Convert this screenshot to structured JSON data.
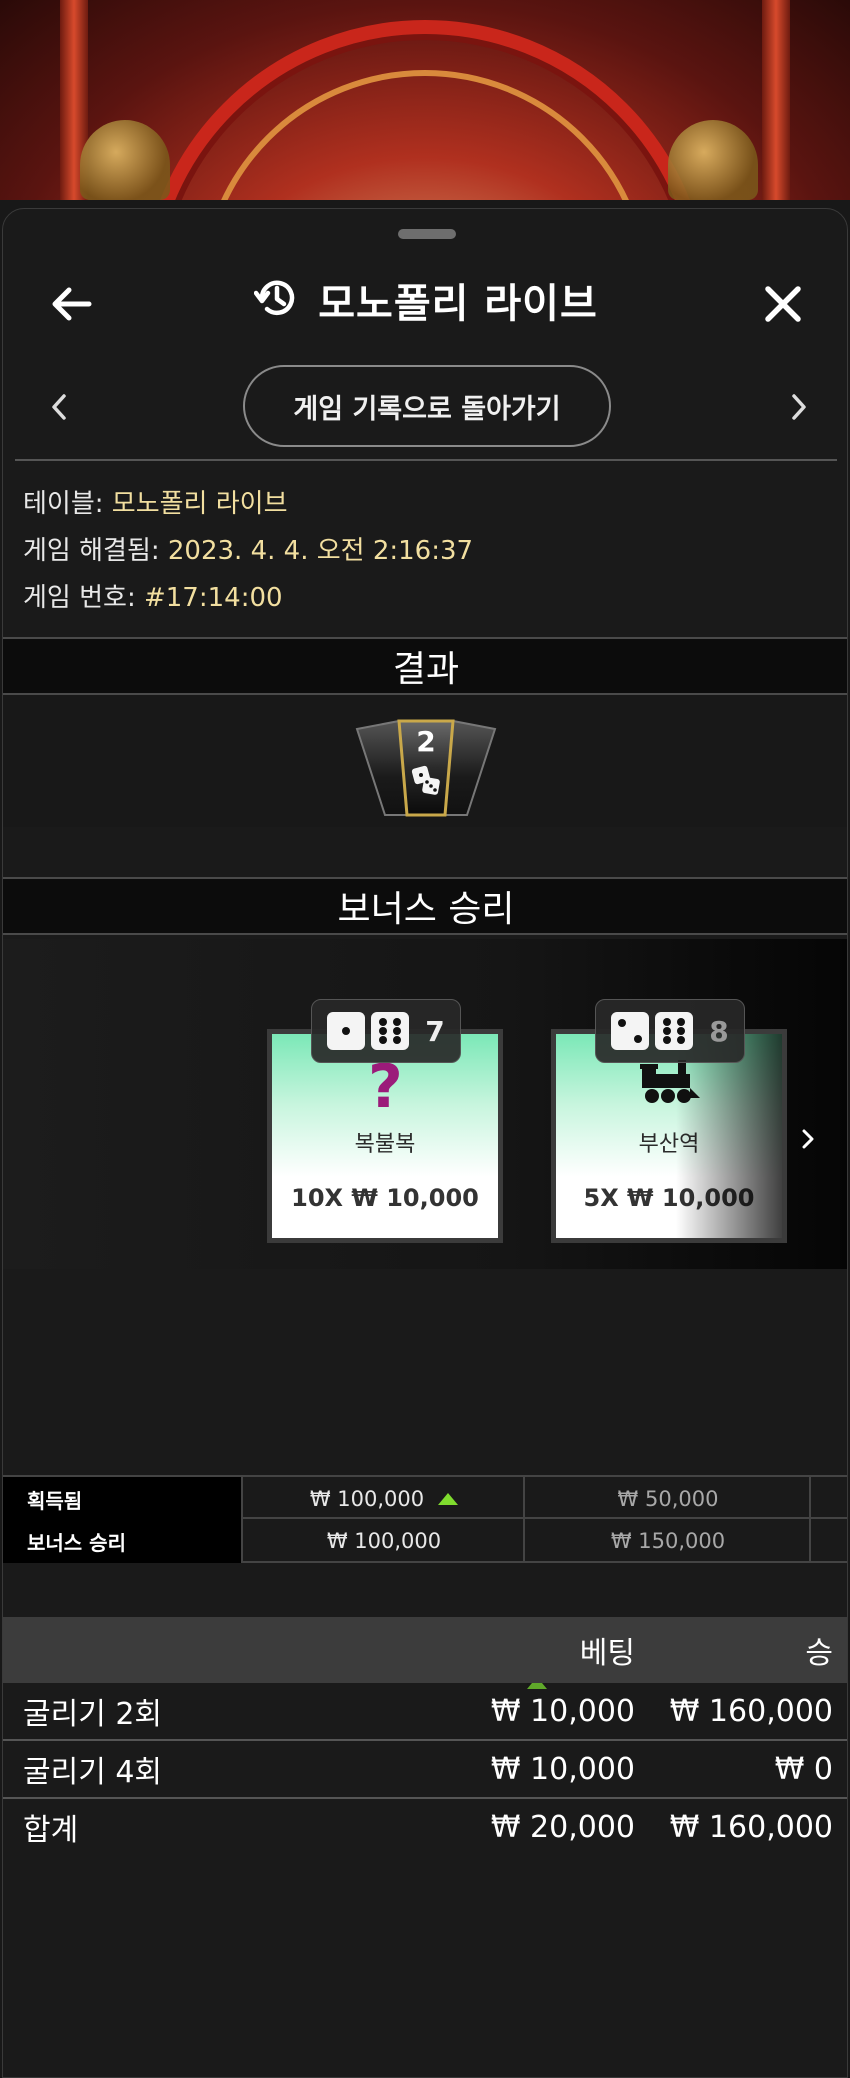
{
  "header": {
    "title": "모노폴리 라이브",
    "back_icon": "arrow-left-icon",
    "history_icon": "history-icon",
    "close_icon": "close-icon"
  },
  "nav": {
    "back_to_history_label": "게임 기록으로 돌아가기"
  },
  "info": {
    "table_label": "테이블:",
    "table_value": "모노폴리 라이브",
    "resolved_label": "게임 해결됨:",
    "resolved_value": "2023. 4. 4. 오전 2:16:37",
    "game_no_label": "게임 번호:",
    "game_no_value": "#17:14:00"
  },
  "result": {
    "heading": "결과",
    "segment_value": "2"
  },
  "bonus": {
    "heading": "보너스 승리",
    "tiles": [
      {
        "dice_sum": "7",
        "symbol": "?",
        "name": "복불복",
        "value": "10X ₩ 10,000"
      },
      {
        "dice_sum": "8",
        "symbol": "train",
        "name": "부산역",
        "value": "5X ₩ 10,000"
      }
    ]
  },
  "summary": {
    "rows": [
      {
        "label": "획득됨",
        "col1": "₩ 100,000",
        "col2": "₩ 50,000"
      },
      {
        "label": "보너스 승리",
        "col1": "₩ 100,000",
        "col2": "₩ 150,000"
      }
    ]
  },
  "bets": {
    "header_bet": "베팅",
    "header_win": "승",
    "rows": [
      {
        "name": "굴리기 2회",
        "bet": "₩ 10,000",
        "win": "₩ 160,000"
      },
      {
        "name": "굴리기 4회",
        "bet": "₩ 10,000",
        "win": "₩ 0"
      }
    ],
    "total": {
      "name": "합계",
      "bet": "₩ 20,000",
      "win": "₩ 160,000"
    }
  },
  "colors": {
    "accent_value": "#f2dfa0",
    "tile_green": "#7be8b7",
    "up_arrow": "#7fdc2e",
    "question_mark": "#9b1b7a"
  }
}
